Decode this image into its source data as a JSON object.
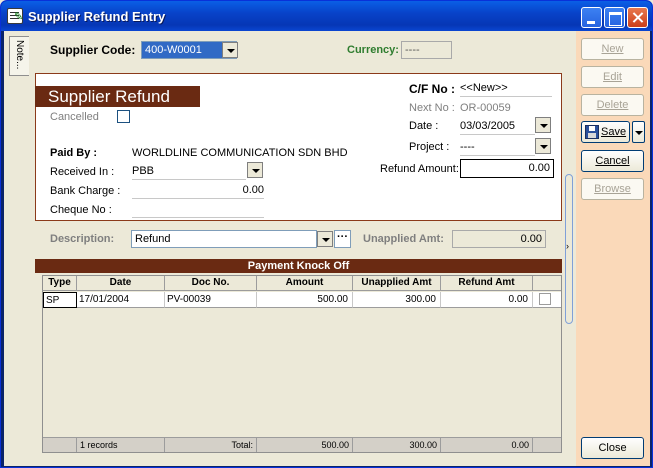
{
  "window": {
    "title": "Supplier Refund Entry"
  },
  "note_tab": {
    "label": "Note..."
  },
  "header": {
    "supplier_code_label": "Supplier Code:",
    "supplier_code_value": "400-W0001",
    "currency_label": "Currency:",
    "currency_value": "----"
  },
  "panel": {
    "banner": "Supplier Refund",
    "cancelled_label": "Cancelled",
    "cf_no_label": "C/F No :",
    "cf_no_value": "<<New>>",
    "next_no_label": "Next No :",
    "next_no_value": "OR-00059",
    "date_label": "Date :",
    "date_value": "03/03/2005",
    "project_label": "Project :",
    "project_value": "----",
    "refund_amount_label": "Refund Amount:",
    "refund_amount_value": "0.00",
    "paid_by_label": "Paid By :",
    "paid_by_value": "WORLDLINE COMMUNICATION SDN BHD",
    "received_in_label": "Received In :",
    "received_in_value": "PBB",
    "bank_charge_label": "Bank Charge :",
    "bank_charge_value": "0.00",
    "cheque_no_label": "Cheque No :",
    "cheque_no_value": ""
  },
  "description": {
    "label": "Description:",
    "value": "Refund",
    "more_label": "···",
    "unapplied_label": "Unapplied Amt:",
    "unapplied_value": "0.00"
  },
  "knockoff": {
    "title": "Payment Knock Off",
    "columns": [
      "Type",
      "Date",
      "Doc No.",
      "Amount",
      "Unapplied Amt",
      "Refund Amt"
    ],
    "rows": [
      {
        "type": "SP",
        "date": "17/01/2004",
        "doc_no": "PV-00039",
        "amount": "500.00",
        "unapplied": "300.00",
        "refund": "0.00"
      }
    ],
    "footer": {
      "records": "1 records",
      "total_label": "Total:",
      "amount": "500.00",
      "unapplied": "300.00",
      "refund": "0.00"
    }
  },
  "actions": {
    "new": "New",
    "edit": "Edit",
    "delete": "Delete",
    "save": "Save",
    "cancel": "Cancel",
    "browse": "Browse",
    "close": "Close"
  },
  "colors": {
    "accent": "#6a2a12",
    "currency_label": "#2f7d2f",
    "action_panel": "#fad9b9"
  }
}
